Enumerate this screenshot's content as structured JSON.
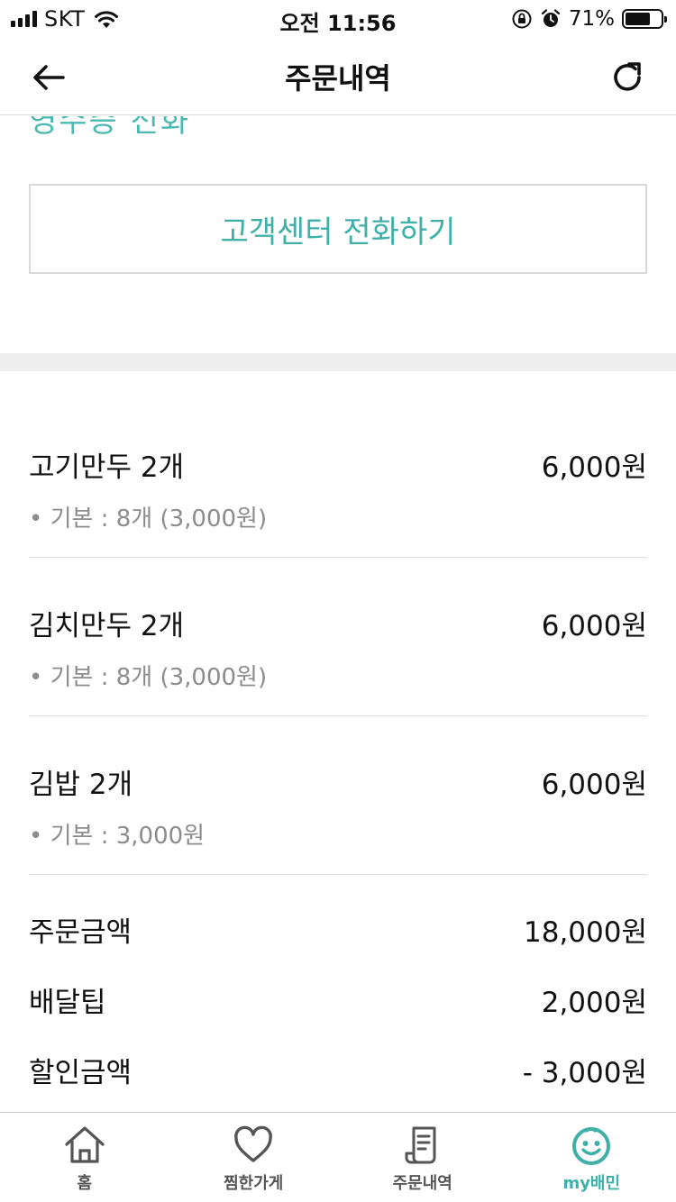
{
  "status_bar": {
    "carrier": "SKT",
    "time": "오전 11:56",
    "battery_percent": "71%",
    "battery_level": 0.71
  },
  "nav": {
    "title": "주문내역",
    "back_icon": "arrow-left-icon",
    "refresh_icon": "refresh-icon"
  },
  "content": {
    "cut_text": "영수증 전화",
    "call_button_label": "고객센터 전화하기",
    "items": [
      {
        "name": "고기만두 2개",
        "price": "6,000원",
        "option": "• 기본 : 8개 (3,000원)"
      },
      {
        "name": "김치만두 2개",
        "price": "6,000원",
        "option": "• 기본 : 8개 (3,000원)"
      },
      {
        "name": "김밥 2개",
        "price": "6,000원",
        "option": "• 기본 : 3,000원"
      }
    ],
    "summary": [
      {
        "label": "주문금액",
        "value": "18,000원"
      },
      {
        "label": "배달팁",
        "value": "2,000원"
      },
      {
        "label": "할인금액",
        "value": "- 3,000원"
      }
    ]
  },
  "tab_bar": {
    "tabs": [
      {
        "label": "홈",
        "icon": "home-icon",
        "active": false
      },
      {
        "label": "찜한가게",
        "icon": "heart-icon",
        "active": false
      },
      {
        "label": "주문내역",
        "icon": "receipt-icon",
        "active": false
      },
      {
        "label": "my배민",
        "icon": "smiley-icon",
        "active": true
      }
    ],
    "accent_color": "#3fb0a8"
  }
}
